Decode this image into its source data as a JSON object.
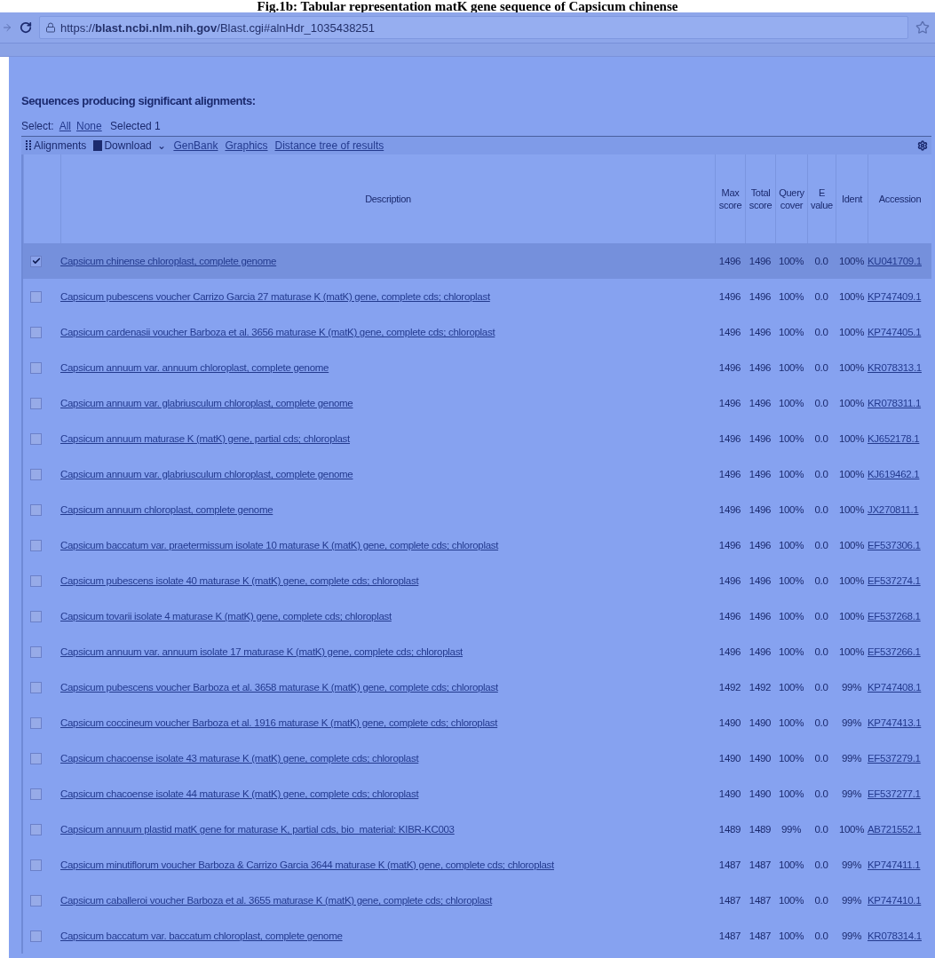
{
  "caption": "Fig.1b: Tabular representation matK gene sequence of Capsicum chinense",
  "address_bar": {
    "url": "https://**blast.ncbi.nlm.nih.gov**/Blast.cgi#alnHdr_1035438251"
  },
  "section_title": "Sequences producing significant alignments:",
  "select_bar": {
    "label": "Select:",
    "links": [
      "All",
      "None"
    ],
    "status": "Selected 1"
  },
  "toolbar": {
    "items": [
      {
        "kind": "handle",
        "label": "Alignments"
      },
      {
        "kind": "download",
        "label": "Download",
        "caret": "⌄"
      },
      {
        "kind": "link",
        "label": "GenBank"
      },
      {
        "kind": "link",
        "label": "Graphics"
      },
      {
        "kind": "link",
        "label": "Distance tree of results"
      }
    ]
  },
  "table": {
    "columns": [
      "Description",
      "Max score",
      "Total score",
      "Query cover",
      "E value",
      "Ident",
      "Accession"
    ],
    "rows": [
      {
        "description": "Capsicum chinense chloroplast, complete genome",
        "max_score": "1496",
        "total_score": "1496",
        "query_cover": "100%",
        "e_value": "0.0",
        "ident": "100%",
        "accession": "KU041709.1",
        "checked": true,
        "selected": true
      },
      {
        "description": "Capsicum pubescens voucher Carrizo Garcia 27 maturase K (matK) gene, complete cds; chloroplast",
        "max_score": "1496",
        "total_score": "1496",
        "query_cover": "100%",
        "e_value": "0.0",
        "ident": "100%",
        "accession": "KP747409.1",
        "checked": false,
        "selected": false
      },
      {
        "description": "Capsicum cardenasii voucher Barboza et al. 3656 maturase K (matK) gene, complete cds; chloroplast",
        "max_score": "1496",
        "total_score": "1496",
        "query_cover": "100%",
        "e_value": "0.0",
        "ident": "100%",
        "accession": "KP747405.1",
        "checked": false,
        "selected": false
      },
      {
        "description": "Capsicum annuum var. annuum chloroplast, complete genome",
        "max_score": "1496",
        "total_score": "1496",
        "query_cover": "100%",
        "e_value": "0.0",
        "ident": "100%",
        "accession": "KR078313.1",
        "checked": false,
        "selected": false
      },
      {
        "description": "Capsicum annuum var. glabriusculum chloroplast, complete genome",
        "max_score": "1496",
        "total_score": "1496",
        "query_cover": "100%",
        "e_value": "0.0",
        "ident": "100%",
        "accession": "KR078311.1",
        "checked": false,
        "selected": false
      },
      {
        "description": "Capsicum annuum maturase K (matK) gene, partial cds; chloroplast",
        "max_score": "1496",
        "total_score": "1496",
        "query_cover": "100%",
        "e_value": "0.0",
        "ident": "100%",
        "accession": "KJ652178.1",
        "checked": false,
        "selected": false
      },
      {
        "description": "Capsicum annuum var. glabriusculum chloroplast, complete genome",
        "max_score": "1496",
        "total_score": "1496",
        "query_cover": "100%",
        "e_value": "0.0",
        "ident": "100%",
        "accession": "KJ619462.1",
        "checked": false,
        "selected": false
      },
      {
        "description": "Capsicum annuum chloroplast, complete genome",
        "max_score": "1496",
        "total_score": "1496",
        "query_cover": "100%",
        "e_value": "0.0",
        "ident": "100%",
        "accession": "JX270811.1",
        "checked": false,
        "selected": false
      },
      {
        "description": "Capsicum baccatum var. praetermissum isolate 10 maturase K (matK) gene, complete cds; chloroplast",
        "max_score": "1496",
        "total_score": "1496",
        "query_cover": "100%",
        "e_value": "0.0",
        "ident": "100%",
        "accession": "EF537306.1",
        "checked": false,
        "selected": false
      },
      {
        "description": "Capsicum pubescens isolate 40 maturase K (matK) gene, complete cds; chloroplast",
        "max_score": "1496",
        "total_score": "1496",
        "query_cover": "100%",
        "e_value": "0.0",
        "ident": "100%",
        "accession": "EF537274.1",
        "checked": false,
        "selected": false
      },
      {
        "description": "Capsicum tovarii isolate 4 maturase K (matK) gene, complete cds; chloroplast",
        "max_score": "1496",
        "total_score": "1496",
        "query_cover": "100%",
        "e_value": "0.0",
        "ident": "100%",
        "accession": "EF537268.1",
        "checked": false,
        "selected": false
      },
      {
        "description": "Capsicum annuum var. annuum isolate 17 maturase K (matK) gene, complete cds; chloroplast",
        "max_score": "1496",
        "total_score": "1496",
        "query_cover": "100%",
        "e_value": "0.0",
        "ident": "100%",
        "accession": "EF537266.1",
        "checked": false,
        "selected": false
      },
      {
        "description": "Capsicum pubescens voucher Barboza et al. 3658 maturase K (matK) gene, complete cds; chloroplast",
        "max_score": "1492",
        "total_score": "1492",
        "query_cover": "100%",
        "e_value": "0.0",
        "ident": "99%",
        "accession": "KP747408.1",
        "checked": false,
        "selected": false
      },
      {
        "description": "Capsicum coccineum voucher Barboza et al. 1916 maturase K (matK) gene, complete cds; chloroplast",
        "max_score": "1490",
        "total_score": "1490",
        "query_cover": "100%",
        "e_value": "0.0",
        "ident": "99%",
        "accession": "KP747413.1",
        "checked": false,
        "selected": false
      },
      {
        "description": "Capsicum chacoense isolate 43 maturase K (matK) gene, complete cds; chloroplast",
        "max_score": "1490",
        "total_score": "1490",
        "query_cover": "100%",
        "e_value": "0.0",
        "ident": "99%",
        "accession": "EF537279.1",
        "checked": false,
        "selected": false
      },
      {
        "description": "Capsicum chacoense isolate 44 maturase K (matK) gene, complete cds; chloroplast",
        "max_score": "1490",
        "total_score": "1490",
        "query_cover": "100%",
        "e_value": "0.0",
        "ident": "99%",
        "accession": "EF537277.1",
        "checked": false,
        "selected": false
      },
      {
        "description": "Capsicum annuum plastid matK gene for maturase K, partial cds, bio_material: KIBR-KC003",
        "max_score": "1489",
        "total_score": "1489",
        "query_cover": "99%",
        "e_value": "0.0",
        "ident": "100%",
        "accession": "AB721552.1",
        "checked": false,
        "selected": false
      },
      {
        "description": "Capsicum minutiflorum voucher Barboza & Carrizo Garcia 3644 maturase K (matK) gene, complete cds; chloroplast",
        "max_score": "1487",
        "total_score": "1487",
        "query_cover": "100%",
        "e_value": "0.0",
        "ident": "99%",
        "accession": "KP747411.1",
        "checked": false,
        "selected": false
      },
      {
        "description": "Capsicum caballeroi voucher Barboza et al. 3655 maturase K (matK) gene, complete cds; chloroplast",
        "max_score": "1487",
        "total_score": "1487",
        "query_cover": "100%",
        "e_value": "0.0",
        "ident": "99%",
        "accession": "KP747410.1",
        "checked": false,
        "selected": false
      },
      {
        "description": "Capsicum baccatum var. baccatum chloroplast, complete genome",
        "max_score": "1487",
        "total_score": "1487",
        "query_cover": "100%",
        "e_value": "0.0",
        "ident": "99%",
        "accession": "KR078314.1",
        "checked": false,
        "selected": false
      }
    ]
  }
}
